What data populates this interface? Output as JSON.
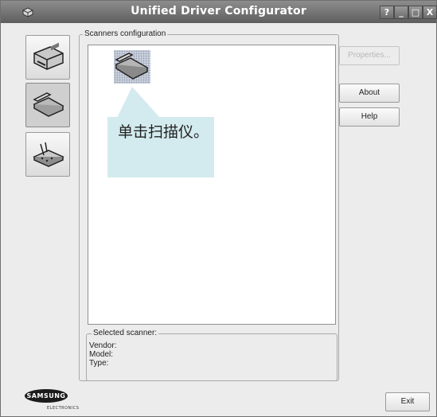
{
  "window": {
    "title": "Unified Driver Configurator",
    "controls": {
      "help": "?",
      "minimize": "_",
      "maximize": "□",
      "close": "X"
    }
  },
  "sidebar": {
    "items": [
      {
        "name": "printers-configuration",
        "icon": "printer-icon",
        "active": false
      },
      {
        "name": "scanners-configuration",
        "icon": "scanner-icon",
        "active": true
      },
      {
        "name": "ports-configuration",
        "icon": "port-icon",
        "active": false
      }
    ]
  },
  "scanners_group": {
    "label": "Scanners configuration",
    "list": [
      {
        "icon": "scanner-icon",
        "selected": true
      }
    ]
  },
  "buttons": {
    "properties": "Properties...",
    "about": "About",
    "help": "Help",
    "exit": "Exit"
  },
  "callout": {
    "text": "单击扫描仪。"
  },
  "selected_scanner": {
    "label": "Selected scanner:",
    "vendor_label": "Vendor:",
    "model_label": "Model:",
    "type_label": "Type:"
  },
  "logo": {
    "brand": "SAMSUNG",
    "sub": "ELECTRONICS"
  },
  "colors": {
    "titlebar": "#6e6e6e",
    "callout_bg": "#d3ebee",
    "window_bg": "#ececec"
  }
}
